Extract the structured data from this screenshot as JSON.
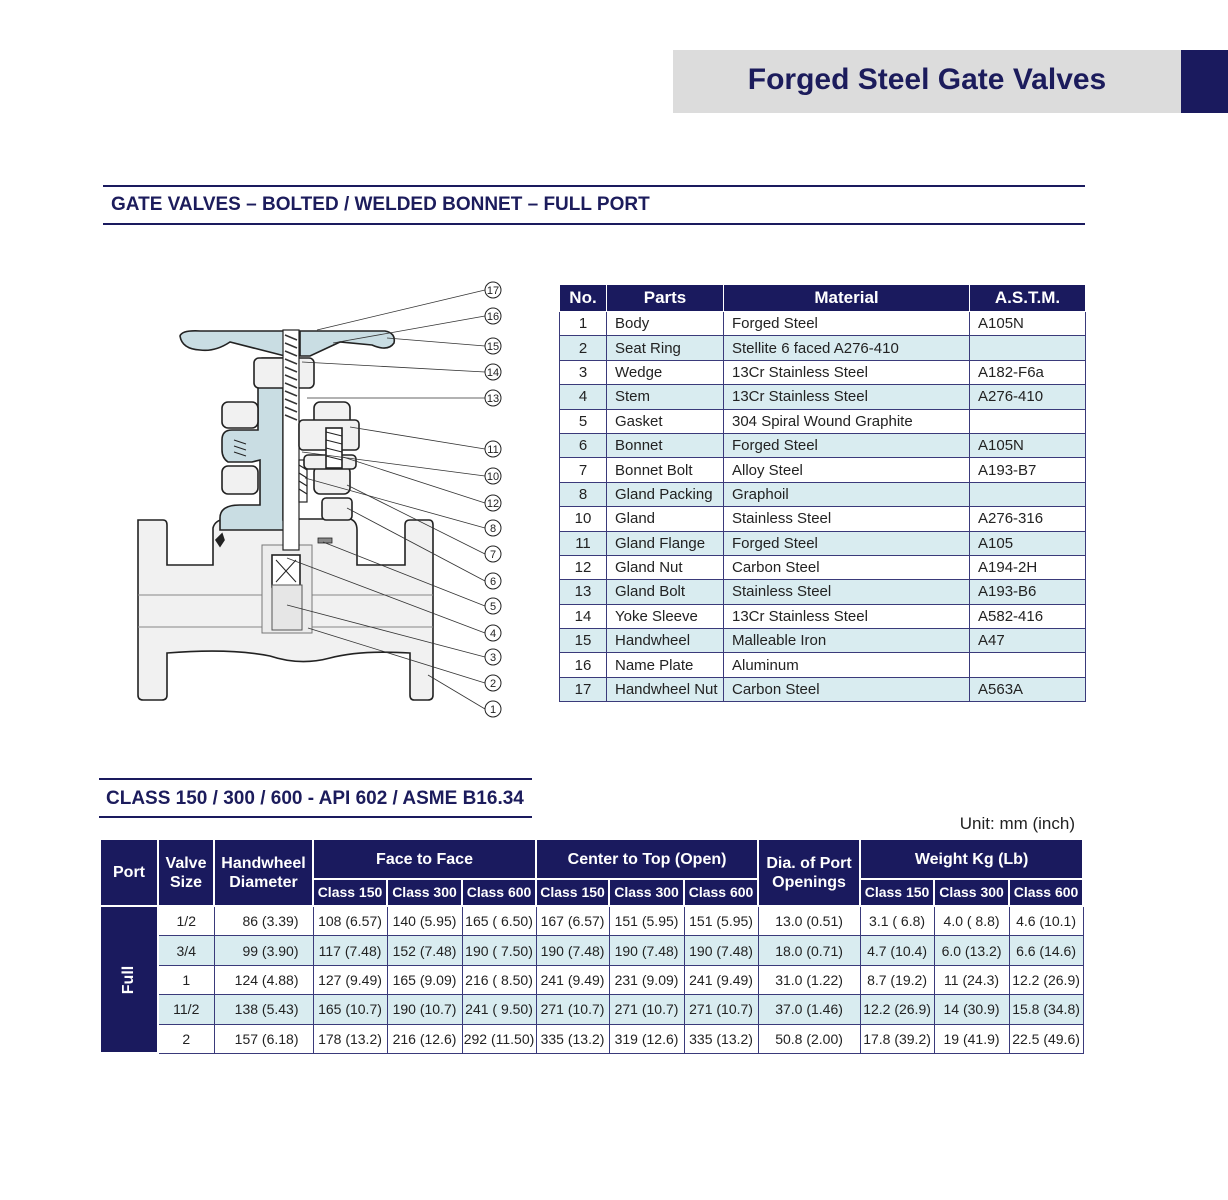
{
  "header": {
    "title": "Forged Steel Gate Valves",
    "accent_color": "#1a1a5e",
    "banner_color": "#dcdcdc"
  },
  "section1": {
    "title": "GATE VALVES – BOLTED / WELDED BONNET – FULL PORT"
  },
  "diagram": {
    "callouts": [
      "17",
      "16",
      "15",
      "14",
      "13",
      "11",
      "10",
      "12",
      "8",
      "7",
      "6",
      "5",
      "4",
      "3",
      "2",
      "1"
    ]
  },
  "parts_table": {
    "headers": [
      "No.",
      "Parts",
      "Material",
      "A.S.T.M."
    ],
    "rows": [
      [
        "1",
        "Body",
        "Forged Steel",
        "A105N"
      ],
      [
        "2",
        "Seat Ring",
        "Stellite 6 faced A276-410",
        ""
      ],
      [
        "3",
        "Wedge",
        "13Cr Stainless Steel",
        "A182-F6a"
      ],
      [
        "4",
        "Stem",
        "13Cr Stainless Steel",
        "A276-410"
      ],
      [
        "5",
        "Gasket",
        "304 Spiral Wound Graphite",
        ""
      ],
      [
        "6",
        "Bonnet",
        "Forged Steel",
        "A105N"
      ],
      [
        "7",
        "Bonnet Bolt",
        "Alloy Steel",
        "A193-B7"
      ],
      [
        "8",
        "Gland Packing",
        "Graphoil",
        ""
      ],
      [
        "10",
        "Gland",
        "Stainless Steel",
        "A276-316"
      ],
      [
        "11",
        "Gland Flange",
        "Forged Steel",
        "A105"
      ],
      [
        "12",
        "Gland Nut",
        "Carbon Steel",
        "A194-2H"
      ],
      [
        "13",
        "Gland Bolt",
        "Stainless Steel",
        "A193-B6"
      ],
      [
        "14",
        "Yoke Sleeve",
        "13Cr Stainless Steel",
        "A582-416"
      ],
      [
        "15",
        "Handwheel",
        "Malleable Iron",
        "A47"
      ],
      [
        "16",
        "Name Plate",
        "Aluminum",
        ""
      ],
      [
        "17",
        "Handwheel Nut",
        "Carbon Steel",
        "A563A"
      ]
    ]
  },
  "section2": {
    "title": "CLASS  150 / 300 / 600 - API 602 / ASME B16.34",
    "unit": "Unit: mm (inch)"
  },
  "spec_table": {
    "headers": {
      "port": "Port",
      "valve_size": "Valve Size",
      "handwheel": "Handwheel Diameter",
      "face_to_face": "Face to Face",
      "center_to_top": "Center to Top (Open)",
      "dia_port": "Dia. of Port Openings",
      "weight": "Weight Kg (Lb)",
      "classes": [
        "Class 150",
        "Class 300",
        "Class 600"
      ]
    },
    "port_label": "Full",
    "rows": [
      [
        "1/2",
        "86 (3.39)",
        "108 (6.57)",
        "140 (5.95)",
        "165 ( 6.50)",
        "167 (6.57)",
        "151 (5.95)",
        "151 (5.95)",
        "13.0 (0.51)",
        "3.1 ( 6.8)",
        "4.0 ( 8.8)",
        "4.6 (10.1)"
      ],
      [
        "3/4",
        "99 (3.90)",
        "117 (7.48)",
        "152 (7.48)",
        "190 ( 7.50)",
        "190 (7.48)",
        "190 (7.48)",
        "190 (7.48)",
        "18.0 (0.71)",
        "4.7 (10.4)",
        "6.0 (13.2)",
        "6.6 (14.6)"
      ],
      [
        "1",
        "124 (4.88)",
        "127 (9.49)",
        "165 (9.09)",
        "216 ( 8.50)",
        "241 (9.49)",
        "231 (9.09)",
        "241 (9.49)",
        "31.0 (1.22)",
        "8.7 (19.2)",
        "11 (24.3)",
        "12.2 (26.9)"
      ],
      [
        "11/2",
        "138 (5.43)",
        "165 (10.7)",
        "190 (10.7)",
        "241 ( 9.50)",
        "271 (10.7)",
        "271 (10.7)",
        "271 (10.7)",
        "37.0 (1.46)",
        "12.2 (26.9)",
        "14 (30.9)",
        "15.8 (34.8)"
      ],
      [
        "2",
        "157 (6.18)",
        "178 (13.2)",
        "216 (12.6)",
        "292 (11.50)",
        "335 (13.2)",
        "319 (12.6)",
        "335 (13.2)",
        "50.8 (2.00)",
        "17.8 (39.2)",
        "19 (41.9)",
        "22.5 (49.6)"
      ]
    ]
  }
}
